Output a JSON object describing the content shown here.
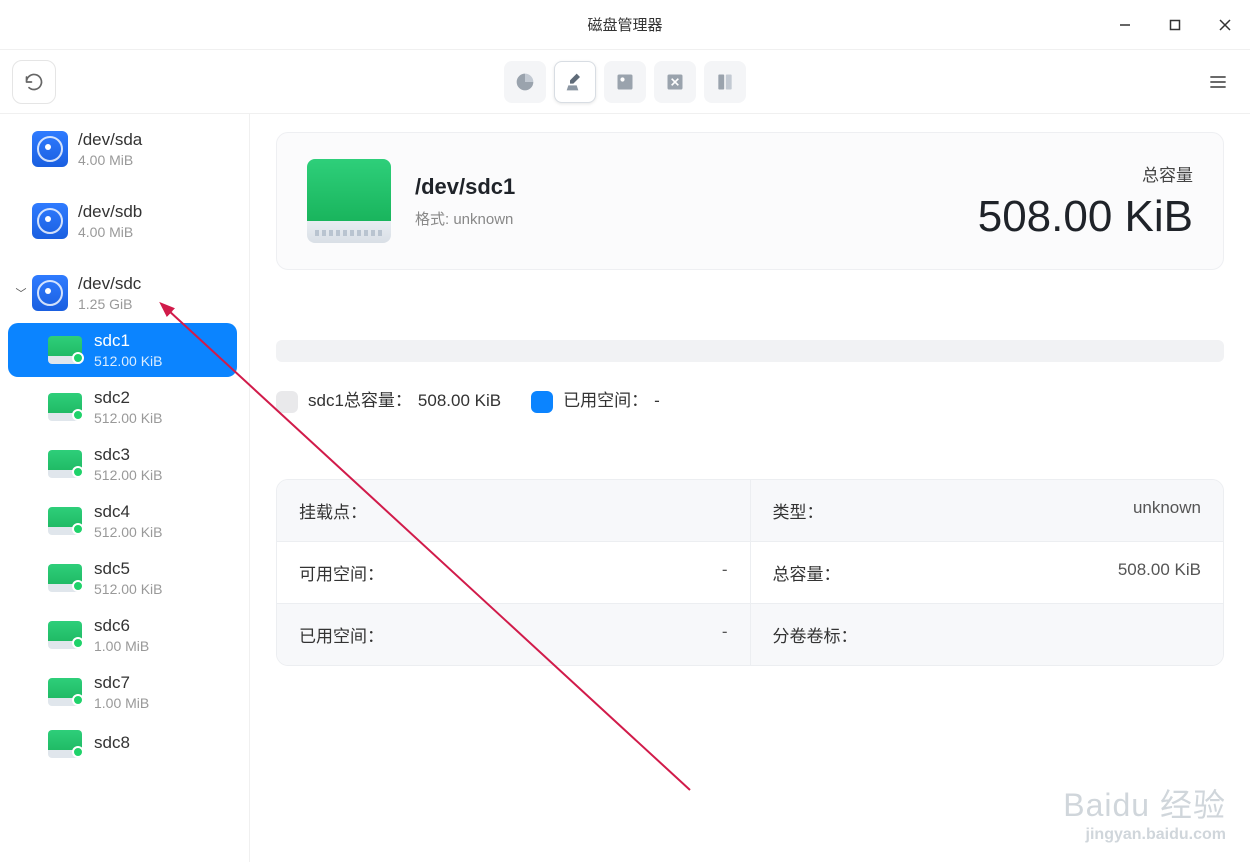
{
  "window": {
    "title": "磁盘管理器"
  },
  "sidebar": {
    "disks": [
      {
        "name": "/dev/sda",
        "size": "4.00 MiB",
        "expanded": false
      },
      {
        "name": "/dev/sdb",
        "size": "4.00 MiB",
        "expanded": false
      },
      {
        "name": "/dev/sdc",
        "size": "1.25 GiB",
        "expanded": true,
        "parts": [
          {
            "name": "sdc1",
            "size": "512.00 KiB",
            "selected": true
          },
          {
            "name": "sdc2",
            "size": "512.00 KiB"
          },
          {
            "name": "sdc3",
            "size": "512.00 KiB"
          },
          {
            "name": "sdc4",
            "size": "512.00 KiB"
          },
          {
            "name": "sdc5",
            "size": "512.00 KiB"
          },
          {
            "name": "sdc6",
            "size": "1.00 MiB"
          },
          {
            "name": "sdc7",
            "size": "1.00 MiB"
          },
          {
            "name": "sdc8",
            "size": ""
          }
        ]
      }
    ]
  },
  "main": {
    "path": "/dev/sdc1",
    "format_label": "格式: unknown",
    "cap_label": "总容量",
    "cap_value": "508.00 KiB",
    "legend_total_label": "sdc1总容量：",
    "legend_total_value": "508.00 KiB",
    "legend_used_label": "已用空间：",
    "legend_used_value": "-",
    "table": {
      "mount_label": "挂载点：",
      "mount_value": "",
      "type_label": "类型：",
      "type_value": "unknown",
      "avail_label": "可用空间：",
      "avail_value": "-",
      "total_label": "总容量：",
      "total_value": "508.00 KiB",
      "used_label": "已用空间：",
      "used_value": "-",
      "volume_label": "分卷卷标：",
      "volume_value": ""
    }
  },
  "watermark": {
    "brand": "Baidu",
    "cn": "经验",
    "url": "jingyan.baidu.com"
  }
}
